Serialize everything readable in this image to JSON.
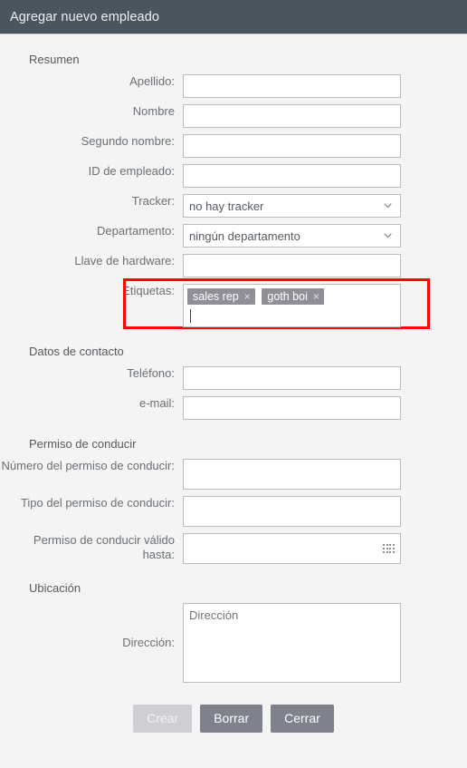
{
  "window": {
    "title": "Agregar nuevo empleado",
    "header_bg": "#4b555f",
    "page_bg": "#f4f4f4",
    "highlight_color": "#fb0606",
    "tag_bg": "#8e8f97",
    "button_bg": "#7e828c",
    "button_disabled_bg": "#cdcfd3"
  },
  "sections": {
    "summary": {
      "title": "Resumen",
      "fields": {
        "last_name_label": "Apellido:",
        "last_name_value": "",
        "first_name_label": "Nombre",
        "first_name_value": "",
        "middle_name_label": "Segundo nombre:",
        "middle_name_value": "",
        "employee_id_label": "ID de empleado:",
        "employee_id_value": "",
        "tracker_label": "Tracker:",
        "tracker_value": "no hay tracker",
        "department_label": "Departamento:",
        "department_value": "ningún departamento",
        "hardware_key_label": "Llave de hardware:",
        "hardware_key_value": "",
        "tags_label": "Etiquetas:",
        "tags": [
          {
            "text": "sales rep",
            "remove": "×"
          },
          {
            "text": "goth boi",
            "remove": "×"
          }
        ]
      }
    },
    "contact": {
      "title": "Datos de contacto",
      "fields": {
        "phone_label": "Teléfono:",
        "phone_value": "",
        "email_label": "e-mail:",
        "email_value": ""
      }
    },
    "license": {
      "title": "Permiso de conducir",
      "fields": {
        "number_label": "Número del permiso de conducir:",
        "number_value": "",
        "type_label": "Tipo del permiso de conducir:",
        "type_value": "",
        "valid_until_label": "Permiso de conducir válido hasta:",
        "valid_until_value": ""
      }
    },
    "location": {
      "title": "Ubicación",
      "fields": {
        "address_label": "Dirección:",
        "address_value": "",
        "address_placeholder": "Dirección"
      }
    }
  },
  "footer": {
    "create_label": "Crear",
    "delete_label": "Borrar",
    "close_label": "Cerrar"
  }
}
